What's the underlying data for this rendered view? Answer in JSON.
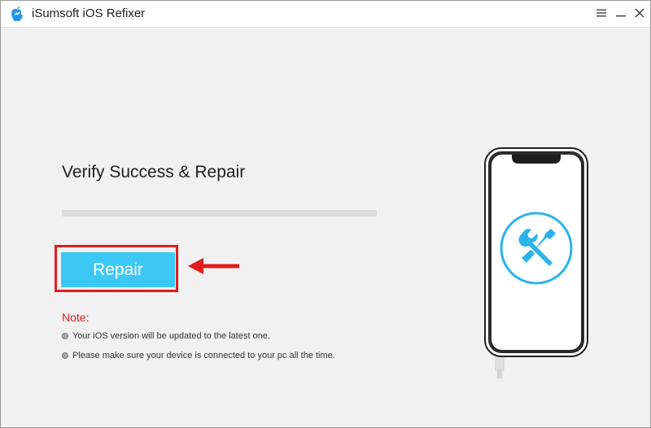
{
  "window": {
    "title": "iSumsoft iOS Refixer",
    "controls": {
      "menu": "menu-icon",
      "minimize": "minimize-icon",
      "close": "close-icon"
    }
  },
  "main": {
    "heading": "Verify Success & Repair",
    "progress_percent": 0,
    "repair_button": "Repair",
    "note": {
      "label": "Note:",
      "items": [
        "Your iOS version will be updated to the latest one.",
        "Please make sure your device is connected to your pc all the time."
      ]
    }
  },
  "illustration": {
    "icon": "wrench-screwdriver-icon"
  },
  "colors": {
    "accent": "#3cc8f5",
    "highlight": "#e11d1d",
    "background": "#f1f1f1"
  }
}
